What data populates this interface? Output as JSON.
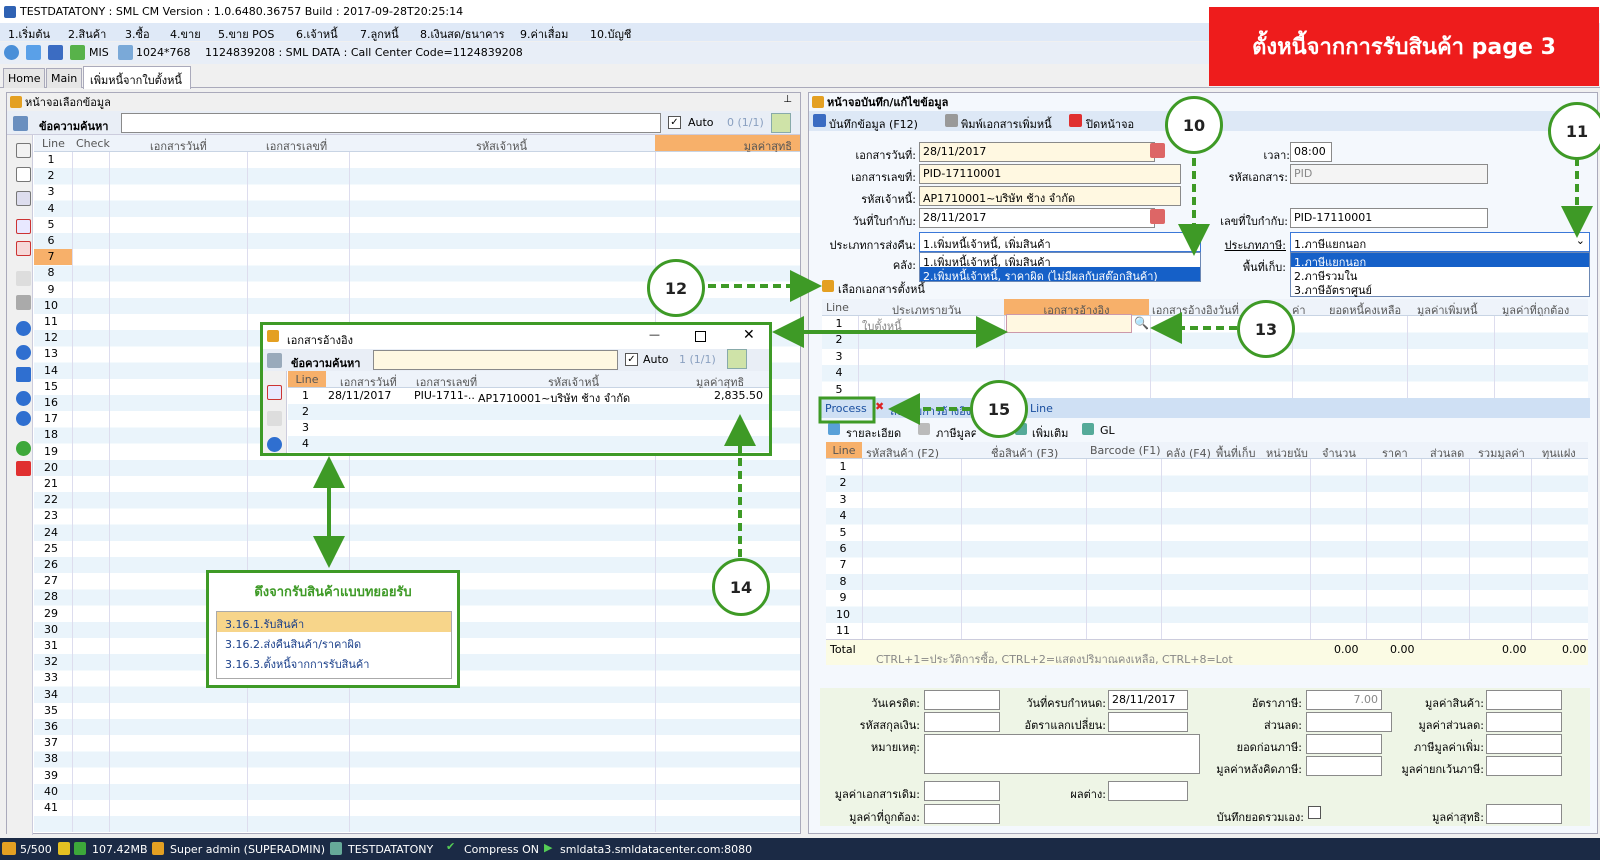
{
  "window_title": "TESTDATATONY : SML CM Version : 1.0.6480.36757  Build : 2017-09-28T20:25:14",
  "menu": [
    "1.เริ่มต้น",
    "2.สินค้า",
    "3.ซื้อ",
    "4.ขาย",
    "5.ขาย POS",
    "6.เจ้าหนี้",
    "7.ลูกหนี้",
    "8.เงินสด/ธนาคาร",
    "9.ค่าเสื่อม",
    "10.บัญชี"
  ],
  "toolbar": {
    "mis": "MIS",
    "resolution": "1024*768",
    "info": "1124839208 : SML DATA : Call Center Code=1124839208"
  },
  "tabs": [
    "Home",
    "Main",
    "เพิ่มหนี้จากใบตั้งหนี้"
  ],
  "banner": "ตั้งหนี้จากการรับสินค้า  page 3",
  "left_panel": {
    "title": "หน้าจอเลือกข้อมูล",
    "search_label": "ข้อความค้นหา",
    "auto_label": "Auto",
    "count": "0 (1/1)",
    "columns": [
      "Line",
      "Check",
      "เอกสารวันที่",
      "เอกสารเลขที่",
      "รหัสเจ้าหนี้",
      "มูลค่าสุทธิ"
    ],
    "lines": [
      "1",
      "2",
      "3",
      "4",
      "5",
      "6",
      "7",
      "8",
      "9",
      "10",
      "11",
      "12",
      "13",
      "14",
      "15",
      "16",
      "17",
      "18",
      "19",
      "20",
      "21",
      "22",
      "23",
      "24",
      "25",
      "26",
      "27",
      "28",
      "29",
      "30",
      "31",
      "32",
      "33",
      "34",
      "35",
      "36",
      "37",
      "38",
      "39",
      "40",
      "41"
    ]
  },
  "right_panel": {
    "title": "หน้าจอบันทึก/แก้ไขข้อมูล",
    "save": "บันทึกข้อมูล (F12)",
    "print": "พิมพ์เอกสารเพิ่มหนี้",
    "close": "ปิดหน้าจอ",
    "fields": {
      "doc_date_label": "เอกสารวันที่:",
      "doc_date": "28/11/2017",
      "doc_no_label": "เอกสารเลขที่:",
      "doc_no": "PID-17110001",
      "creditor_label": "รหัสเจ้าหนี้:",
      "creditor": "AP1710001~บริษัท ช้าง จำกัด",
      "tax_date_label": "วันที่ใบกำกับ:",
      "tax_date": "28/11/2017",
      "return_type_label": "ประเภทการส่งคืน:",
      "return_type": "1.เพิ่มหนี้เจ้าหนี้, เพิ่มสินค้า",
      "warehouse_label": "คลัง:",
      "time_label": "เวลา:",
      "time": "08:00",
      "doc_code_label": "รหัสเอกสาร:",
      "doc_code": "PID",
      "tax_no_label": "เลขที่ใบกำกับ:",
      "tax_no": "PID-17110001",
      "tax_type_label": "ประเภทภาษี:",
      "tax_type": "1.ภาษีแยกนอก",
      "location_label": "พื้นที่เก็บ:"
    },
    "return_type_options": [
      "1.เพิ่มหนี้เจ้าหนี้, เพิ่มสินค้า",
      "2.เพิ่มหนี้เจ้าหนี้, ราคาผิด (ไม่มีผลกับสต๊อกสินค้า)"
    ],
    "tax_type_options": [
      "1.ภาษีแยกนอก",
      "2.ภาษีรวมใน",
      "3.ภาษีอัตราศูนย์"
    ],
    "ref_section_title": "เลือกเอกสารตั้งหนี้",
    "ref_columns": [
      "Line",
      "ประเภทรายวัน",
      "เอกสารอ้างอิง",
      "เอกสารอ้างอิงวันที่",
      "ค่า",
      "ยอดหนี้คงเหลือ",
      "มูลค่าเพิ่มหนี้",
      "มูลค่าที่ถูกต้อง"
    ],
    "ref_row1_type": "ใบตั้งหนี้",
    "ref_lines": [
      "1",
      "2",
      "3",
      "4",
      "5"
    ],
    "process": "Process",
    "clear": "ลบรายการอ้างอิง",
    "line_btn": "Line",
    "sub_tabs": [
      "รายละเอียด",
      "ภาษีมูลค่าเพิ่ม",
      "เพิ่มเติม",
      "GL"
    ],
    "detail_columns": [
      "Line",
      "รหัสสินค้า (F2)",
      "ชื่อสินค้า (F3)",
      "Barcode (F1)",
      "คลัง (F4)",
      "พื้นที่เก็บ",
      "หน่วยนับ",
      "จำนวน",
      "ราคา",
      "ส่วนลด",
      "รวมมูลค่า",
      "ทุนแฝง"
    ],
    "detail_lines": [
      "1",
      "2",
      "3",
      "4",
      "5",
      "6",
      "7",
      "8",
      "9",
      "10",
      "11"
    ],
    "total_label": "Total",
    "hint": "CTRL+1=ประวัติการซื้อ, CTRL+2=แสดงปริมาณคงเหลือ, CTRL+8=Lot",
    "totals": [
      "0.00",
      "0.00",
      "0.00",
      "0.00"
    ],
    "footer": {
      "credit_days": "วันเครดิต:",
      "due_date_label": "วันที่ครบกำหนด:",
      "due_date": "28/11/2017",
      "vat_rate_label": "อัตราภาษี:",
      "vat_rate": "7.00",
      "goods_value": "มูลค่าสินค้า:",
      "currency": "รหัสสกุลเงิน:",
      "exchange": "อัตราแลกเปลี่ยน:",
      "discount": "ส่วนลด:",
      "discount_value": "มูลค่าส่วนลด:",
      "remark": "หมายเหตุ:",
      "before_vat": "ยอดก่อนภาษี:",
      "vat_amount": "ภาษีมูลค่าเพิ่ม:",
      "after_vat": "มูลค่าหลังคิดภาษี:",
      "exempt": "มูลค่ายกเว้นภาษี:",
      "old_doc_value": "มูลค่าเอกสารเดิม:",
      "difference": "ผลต่าง:",
      "correct_value": "มูลค่าที่ถูกต้อง:",
      "self_total": "บันทึกยอดรวมเอง:",
      "net_value": "มูลค่าสุทธิ:"
    }
  },
  "popup": {
    "title": "เอกสารอ้างอิง",
    "search_label": "ข้อความค้นหา",
    "auto_label": "Auto",
    "count": "1 (1/1)",
    "columns": [
      "Line",
      "เอกสารวันที่",
      "เอกสารเลขที่",
      "รหัสเจ้าหนี้",
      "มูลค่าสุทธิ"
    ],
    "row": {
      "line": "1",
      "date": "28/11/2017",
      "doc": "PIU-1711-..",
      "creditor": "AP1710001~บริษัท ช้าง จำกัด",
      "value": "2,835.50"
    },
    "lines": [
      "2",
      "3",
      "4"
    ]
  },
  "callout": {
    "title": "ดึงจากรับสินค้าแบบทยอยรับ",
    "items": [
      "3.16.1.รับสินค้า",
      "3.16.2.ส่งคืนสินค้า/ราคาผิด",
      "3.16.3.ตั้งหนี้จากการรับสินค้า"
    ]
  },
  "circles": [
    "10",
    "11",
    "12",
    "13",
    "14",
    "15"
  ],
  "status": {
    "users": "5/500",
    "memory": "107.42MB",
    "user": "Super admin (SUPERADMIN)",
    "db": "TESTDATATONY",
    "compress": "Compress ON",
    "server": "smldata3.smldatacenter.com:8080"
  },
  "colors": {
    "accent_green": "#3e9a26",
    "banner_red": "#ee1c1c",
    "selected_blue": "#1560c8"
  }
}
